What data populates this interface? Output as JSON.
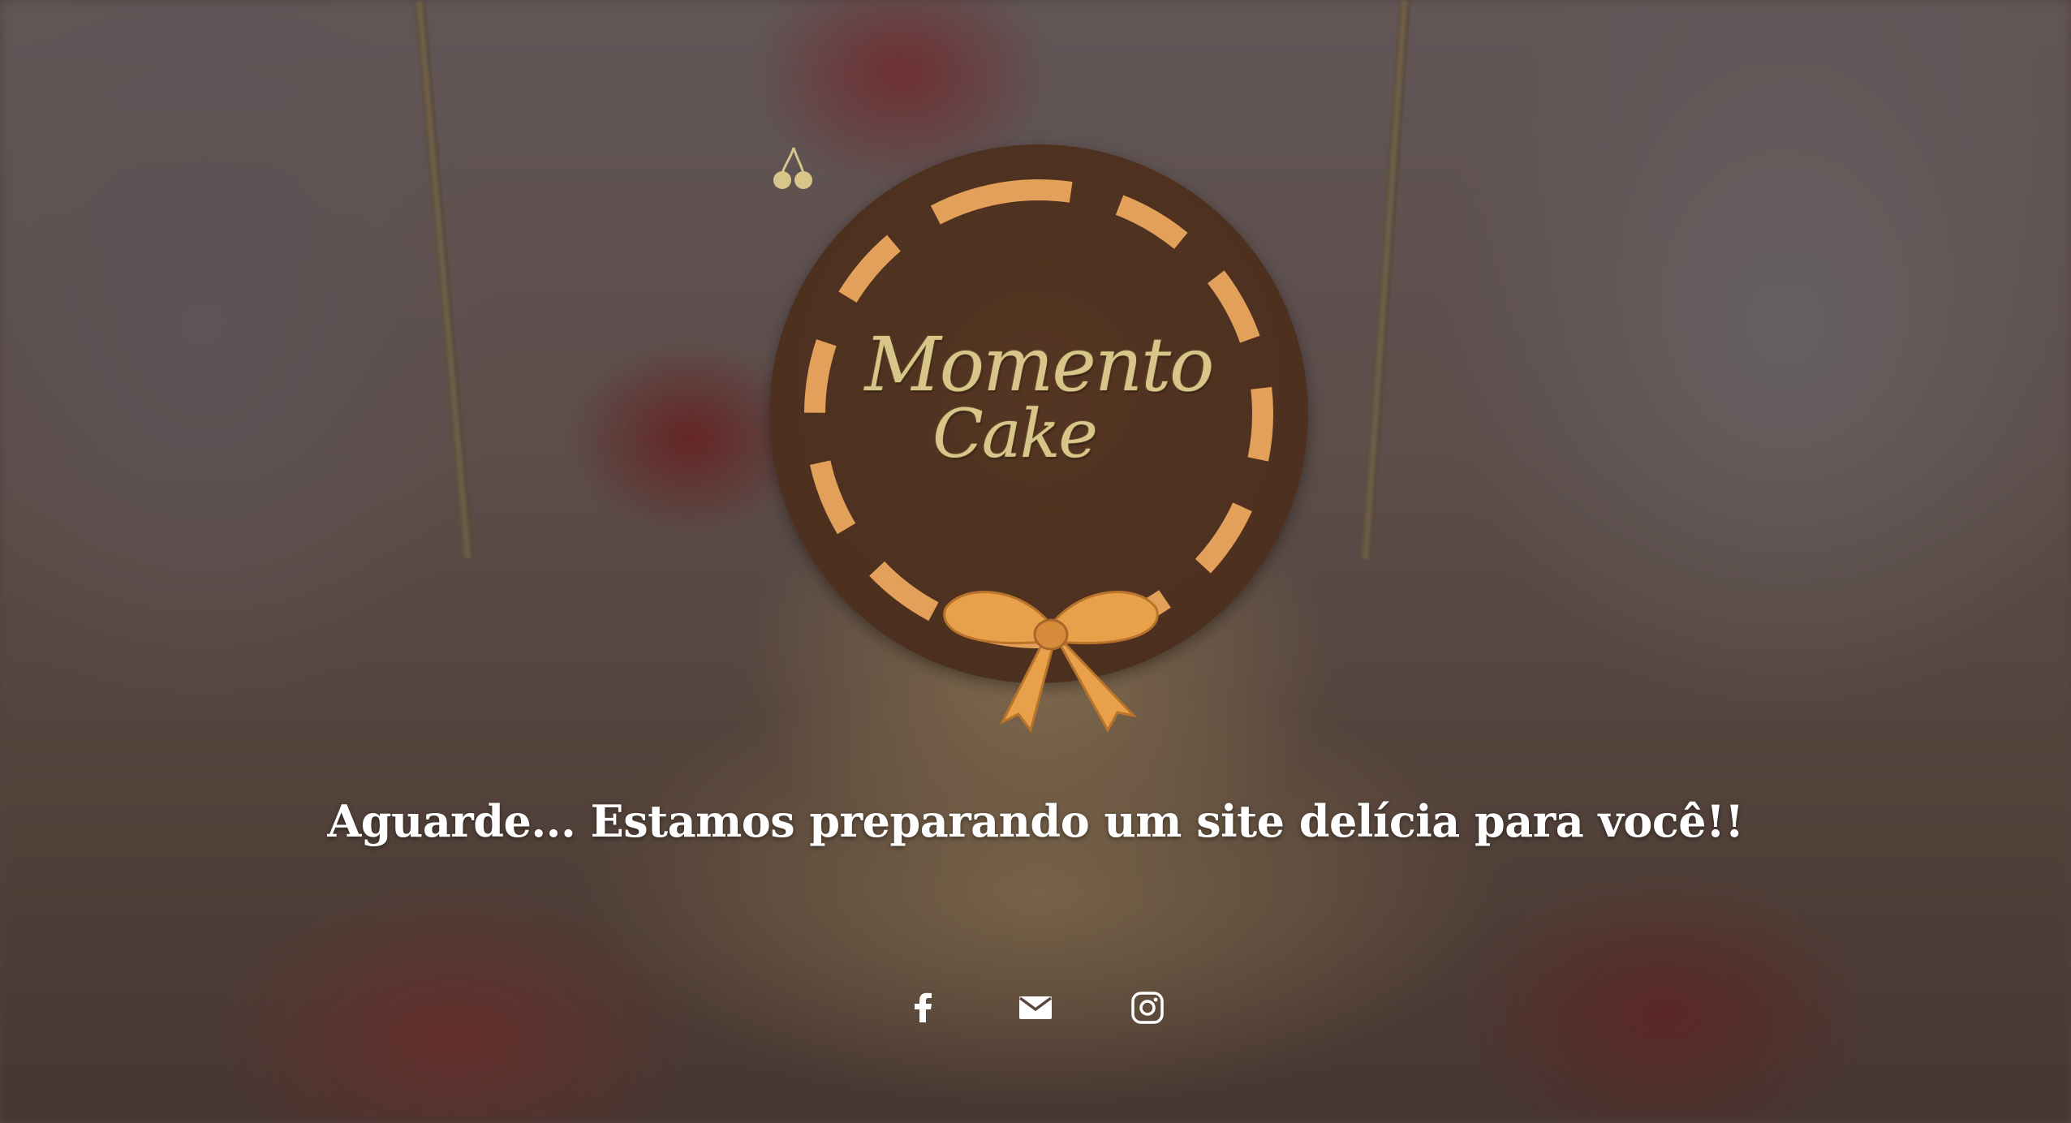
{
  "brand": {
    "logo_line1": "Momento",
    "logo_line2": "Cake"
  },
  "headline": "Aguarde... Estamos preparando um site delícia para você!!",
  "social": [
    {
      "icon": "facebook-icon"
    },
    {
      "icon": "email-icon"
    },
    {
      "icon": "instagram-icon"
    }
  ],
  "colors": {
    "logo_background": "#4d301f",
    "logo_dashes": "#e3a05a",
    "ribbon": "#e8a04a",
    "logo_text": "#d8c58a",
    "headline": "#ffffff",
    "icons": "#ffffff"
  }
}
